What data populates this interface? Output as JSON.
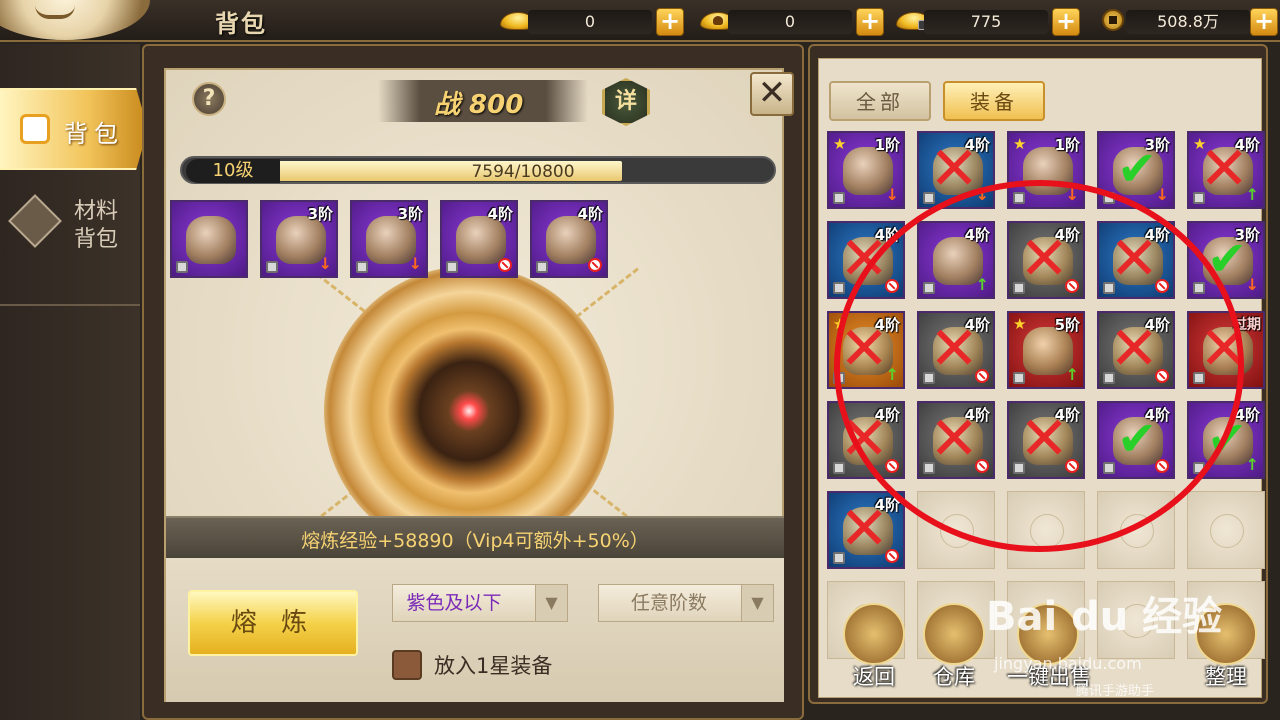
{
  "header": {
    "title": "背包",
    "currencies": [
      {
        "icon": "gold-ingot-icon",
        "value": "0"
      },
      {
        "icon": "bound-ingot-icon",
        "value": "0"
      },
      {
        "icon": "locked-ingot-icon",
        "value": "775"
      },
      {
        "icon": "copper-coin-icon",
        "value": "508.8万"
      }
    ]
  },
  "nav": {
    "bag": "背包",
    "materials": "材料\n背包"
  },
  "smelt": {
    "power": "战 800",
    "detail": "详",
    "help": "?",
    "close": "✕",
    "level": "10级",
    "progress": "7594/10800",
    "progress_value": 0.703,
    "slots": [
      {
        "tier": "",
        "quality": "purple",
        "lock": true,
        "mark": ""
      },
      {
        "tier": "3阶",
        "quality": "purple",
        "lock": true,
        "mark": "down"
      },
      {
        "tier": "3阶",
        "quality": "purple",
        "lock": true,
        "mark": "down"
      },
      {
        "tier": "4阶",
        "quality": "purple",
        "lock": true,
        "mark": "noentry"
      },
      {
        "tier": "4阶",
        "quality": "purple",
        "lock": true,
        "mark": "noentry"
      }
    ],
    "exp_text": "熔炼经验+58890（Vip4可额外+50%）",
    "smelt_button": "熔 炼",
    "color_filter": "紫色及以下",
    "tier_filter": "任意阶数",
    "star_option": "放入1星装备"
  },
  "inventory": {
    "tabs": [
      "全部",
      "装备"
    ],
    "items": [
      {
        "tier": "1阶",
        "quality": "purple",
        "star": true,
        "mark": "down",
        "overlay": ""
      },
      {
        "tier": "4阶",
        "quality": "blue",
        "star": false,
        "mark": "down",
        "overlay": "x"
      },
      {
        "tier": "1阶",
        "quality": "purple",
        "star": true,
        "mark": "down",
        "overlay": ""
      },
      {
        "tier": "3阶",
        "quality": "purple",
        "star": false,
        "mark": "down",
        "overlay": "check"
      },
      {
        "tier": "4阶",
        "quality": "purple",
        "star": true,
        "mark": "up",
        "overlay": "x"
      },
      {
        "tier": "4阶",
        "quality": "blue",
        "star": false,
        "mark": "noentry",
        "overlay": "x"
      },
      {
        "tier": "4阶",
        "quality": "purple",
        "star": false,
        "mark": "up",
        "overlay": ""
      },
      {
        "tier": "4阶",
        "quality": "grey",
        "star": false,
        "mark": "noentry",
        "overlay": "x"
      },
      {
        "tier": "4阶",
        "quality": "blue",
        "star": false,
        "mark": "noentry",
        "overlay": "x"
      },
      {
        "tier": "3阶",
        "quality": "purple",
        "star": false,
        "mark": "down",
        "overlay": "check"
      },
      {
        "tier": "4阶",
        "quality": "orange",
        "star": true,
        "mark": "up",
        "overlay": "x"
      },
      {
        "tier": "4阶",
        "quality": "grey",
        "star": false,
        "mark": "noentry",
        "overlay": "x"
      },
      {
        "tier": "5阶",
        "quality": "red",
        "star": true,
        "mark": "up",
        "overlay": ""
      },
      {
        "tier": "4阶",
        "quality": "grey",
        "star": false,
        "mark": "noentry",
        "overlay": "x"
      },
      {
        "tier": "过期",
        "quality": "red",
        "star": false,
        "mark": "",
        "overlay": "x"
      },
      {
        "tier": "4阶",
        "quality": "grey",
        "star": false,
        "mark": "noentry",
        "overlay": "x"
      },
      {
        "tier": "4阶",
        "quality": "grey",
        "star": false,
        "mark": "noentry",
        "overlay": "x"
      },
      {
        "tier": "4阶",
        "quality": "grey",
        "star": false,
        "mark": "noentry",
        "overlay": "x"
      },
      {
        "tier": "4阶",
        "quality": "purple",
        "star": false,
        "mark": "noentry",
        "overlay": "check"
      },
      {
        "tier": "4阶",
        "quality": "purple",
        "star": false,
        "mark": "up",
        "overlay": "check"
      },
      {
        "tier": "4阶",
        "quality": "blue",
        "star": false,
        "mark": "noentry",
        "overlay": "x"
      }
    ],
    "buttons": [
      "返回",
      "仓库",
      "一键出售",
      "整理"
    ]
  },
  "watermark": {
    "brand": "Bai du 经验",
    "url": "jingyan.baidu.com",
    "source": "腾讯手游助手"
  },
  "colors": {
    "accent_gold": "#f6d273",
    "highlight_red": "#e8101a",
    "quality_purple": "#6a2ab8",
    "quality_blue": "#1e5aa0"
  }
}
